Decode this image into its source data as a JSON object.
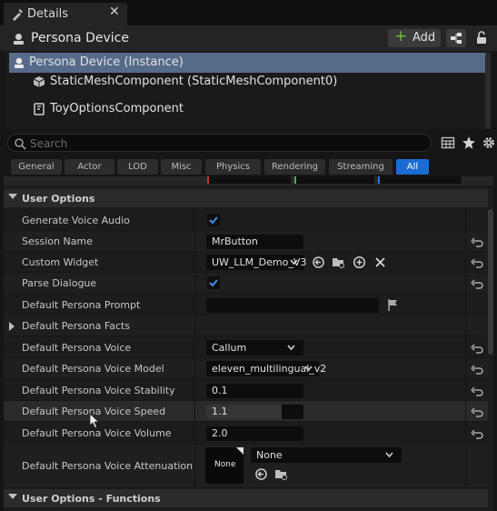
{
  "tab": {
    "title": "Details",
    "close": "✕"
  },
  "header": {
    "title": "Persona Device",
    "add_label": "Add",
    "add_symbol": "+"
  },
  "tree": {
    "items": [
      {
        "label": "Persona Device (Instance)",
        "icon": "actor-icon"
      },
      {
        "label": "StaticMeshComponent (StaticMeshComponent0)",
        "icon": "static-mesh-icon"
      },
      {
        "label": "ToyOptionsComponent",
        "icon": "component-icon"
      }
    ]
  },
  "search": {
    "placeholder": "Search"
  },
  "categories": [
    "General",
    "Actor",
    "LOD",
    "Misc",
    "Physics",
    "Rendering",
    "Streaming",
    "All"
  ],
  "active_category": "All",
  "sections": {
    "user_options": "User Options",
    "user_options_functions": "User Options - Functions"
  },
  "properties": {
    "generate_voice_audio": {
      "label": "Generate Voice Audio",
      "checked": true
    },
    "session_name": {
      "label": "Session Name",
      "value": "MrButton"
    },
    "custom_widget": {
      "label": "Custom Widget",
      "value": "UW_LLM_Demo_V3"
    },
    "parse_dialogue": {
      "label": "Parse Dialogue",
      "checked": true
    },
    "default_persona_prompt": {
      "label": "Default Persona Prompt",
      "value": ""
    },
    "default_persona_facts": {
      "label": "Default Persona Facts"
    },
    "default_persona_voice": {
      "label": "Default Persona Voice",
      "value": "Callum"
    },
    "default_persona_voice_model": {
      "label": "Default Persona Voice Model",
      "value": "eleven_multilingual_v2"
    },
    "default_persona_voice_stability": {
      "label": "Default Persona Voice Stability",
      "value": "0.1"
    },
    "default_persona_voice_speed": {
      "label": "Default Persona Voice Speed",
      "value": "1.1",
      "fill_fraction": 0.78
    },
    "default_persona_voice_volume": {
      "label": "Default Persona Voice Volume",
      "value": "2.0"
    },
    "default_persona_voice_attenuation": {
      "label": "Default Persona Voice Attenuation",
      "thumbnail": "None",
      "value": "None"
    }
  },
  "colors": {
    "accent": "#1a6cd2",
    "selection": "#566b8a",
    "add_green": "#6fbf4a",
    "check_blue": "#3d8ee8"
  }
}
